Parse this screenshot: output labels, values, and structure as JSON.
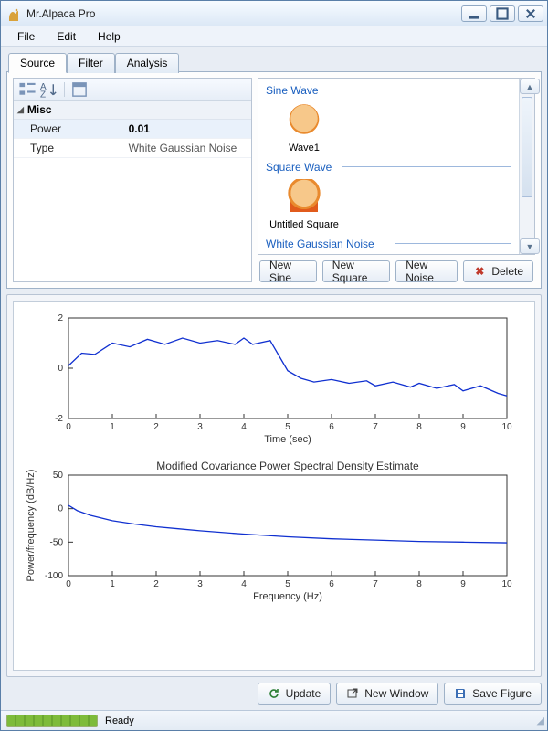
{
  "window": {
    "title": "Mr.Alpaca Pro"
  },
  "menu": {
    "file": "File",
    "edit": "Edit",
    "help": "Help"
  },
  "tabs": {
    "source": "Source",
    "filter": "Filter",
    "analysis": "Analysis"
  },
  "propgrid": {
    "category": "Misc",
    "rows": [
      {
        "k": "Power",
        "v": "0.01"
      },
      {
        "k": "Type",
        "v": "White Gaussian Noise"
      }
    ]
  },
  "gallery": {
    "groups": {
      "sine": {
        "label": "Sine Wave",
        "items": [
          "Wave1"
        ]
      },
      "square": {
        "label": "Square Wave",
        "items": [
          "Untitled Square"
        ]
      },
      "noise": {
        "label": "White Gaussian Noise",
        "items": []
      }
    }
  },
  "buttons": {
    "new_sine": "New Sine",
    "new_square": "New Square",
    "new_noise": "New Noise",
    "delete": "Delete",
    "update": "Update",
    "new_window": "New Window",
    "save_figure": "Save Figure"
  },
  "status": {
    "text": "Ready"
  },
  "chart_data": [
    {
      "type": "line",
      "title": "",
      "xlabel": "Time (sec)",
      "ylabel": "",
      "xlim": [
        0,
        10
      ],
      "ylim": [
        -2,
        2
      ],
      "xticks": [
        0,
        1,
        2,
        3,
        4,
        5,
        6,
        7,
        8,
        9,
        10
      ],
      "yticks": [
        -2,
        0,
        2
      ],
      "x": [
        0,
        0.3,
        0.6,
        1,
        1.4,
        1.8,
        2.2,
        2.6,
        3,
        3.4,
        3.8,
        4,
        4.2,
        4.6,
        4.8,
        5,
        5.3,
        5.6,
        6,
        6.4,
        6.8,
        7,
        7.4,
        7.8,
        8,
        8.4,
        8.8,
        9,
        9.4,
        9.8,
        10
      ],
      "y": [
        0.1,
        0.6,
        0.55,
        1.0,
        0.85,
        1.15,
        0.95,
        1.2,
        1.0,
        1.1,
        0.95,
        1.2,
        0.95,
        1.1,
        0.5,
        -0.1,
        -0.4,
        -0.55,
        -0.45,
        -0.6,
        -0.5,
        -0.7,
        -0.55,
        -0.75,
        -0.6,
        -0.8,
        -0.65,
        -0.9,
        -0.7,
        -1.0,
        -1.1
      ]
    },
    {
      "type": "line",
      "title": "Modified Covariance Power Spectral Density Estimate",
      "xlabel": "Frequency (Hz)",
      "ylabel": "Power/frequency (dB/Hz)",
      "xlim": [
        0,
        10
      ],
      "ylim": [
        -100,
        50
      ],
      "xticks": [
        0,
        1,
        2,
        3,
        4,
        5,
        6,
        7,
        8,
        9,
        10
      ],
      "yticks": [
        -100,
        -50,
        0,
        50
      ],
      "x": [
        0,
        0.2,
        0.5,
        1,
        1.5,
        2,
        2.5,
        3,
        4,
        5,
        6,
        7,
        8,
        9,
        10
      ],
      "y": [
        5,
        -3,
        -10,
        -18,
        -23,
        -27,
        -30,
        -33,
        -38,
        -42,
        -45,
        -47,
        -49,
        -50,
        -51
      ]
    }
  ]
}
